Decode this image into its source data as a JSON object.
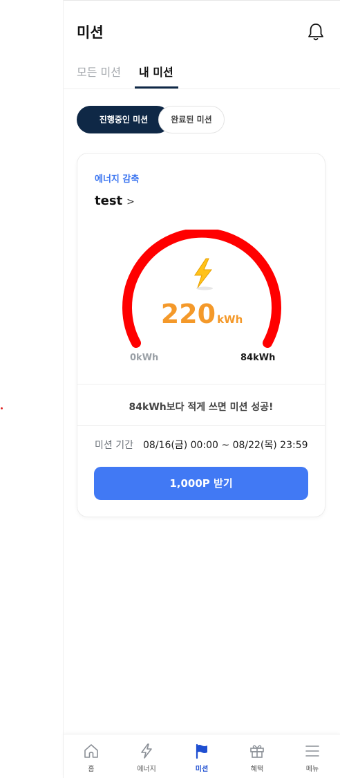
{
  "header": {
    "title": "미션"
  },
  "tabs": [
    {
      "label": "모든 미션",
      "active": false
    },
    {
      "label": "내 미션",
      "active": true
    }
  ],
  "filters": [
    {
      "label": "진행중인 미션",
      "selected": true
    },
    {
      "label": "완료된 미션",
      "selected": false
    }
  ],
  "mission": {
    "type": "에너지 감축",
    "name": "test",
    "chevron": ">",
    "gauge": {
      "value": "220",
      "unit": "kWh",
      "min_label": "0kWh",
      "max_label": "84kWh",
      "arc_color": "#ff0000",
      "value_color": "#f4992a"
    },
    "goal_text": "84kWh보다 적게 쓰면 미션 성공!",
    "period_label": "미션 기간",
    "period_value": "08/16(금) 00:00 ~ 08/22(목) 23:59",
    "reward_button": "1,000P 받기"
  },
  "bottom_nav": [
    {
      "label": "홈",
      "icon": "home-icon",
      "active": false
    },
    {
      "label": "에너지",
      "icon": "bolt-icon",
      "active": false
    },
    {
      "label": "미션",
      "icon": "flag-icon",
      "active": true
    },
    {
      "label": "혜택",
      "icon": "gift-icon",
      "active": false
    },
    {
      "label": "메뉴",
      "icon": "menu-icon",
      "active": false
    }
  ],
  "colors": {
    "navy": "#0f2846",
    "accent_blue": "#4179f4",
    "active_nav": "#1f4fd1"
  }
}
